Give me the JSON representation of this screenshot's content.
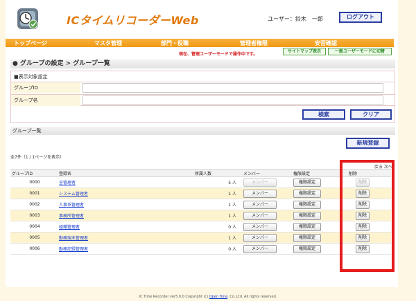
{
  "app": {
    "title": "ICタイムリコーダーWeb"
  },
  "header": {
    "user_label": "ユーザー：鈴木　一郎",
    "logout_label": "ログアウト"
  },
  "nav": {
    "items": [
      "トップページ",
      "マスタ管理",
      "部門・役職",
      "管理者権限",
      "安否確認"
    ]
  },
  "mode": {
    "notice": "現在、管理ユーザーモードで操作中です。",
    "sitemap_label": "サイトマップ表示",
    "switch_label": "一般ユーザーモードに切替"
  },
  "page": {
    "breadcrumb": "● グループの設定 > グループ一覧"
  },
  "search": {
    "section_label": "■表示対象設定",
    "group_id_label": "グループID",
    "group_name_label": "グループ名",
    "group_id_value": "",
    "group_name_value": "",
    "search_label": "検索",
    "clear_label": "クリア"
  },
  "list": {
    "title": "グループ一覧",
    "new_label": "新規登録",
    "count_text": "全7件（1 / 1ページを表示）",
    "pager_text": "戻る 次へ",
    "headers": {
      "id": "グループID",
      "name": "登録名",
      "members_count": "所属人数",
      "members": "メンバー",
      "perm": "権限設定",
      "delete": "削除"
    },
    "rows": [
      {
        "id": "0000",
        "name": "全管理者",
        "count": "5 人",
        "member_label": "メンバー",
        "member_enabled": false,
        "perm_label": "権限設定",
        "delete_label": "削除",
        "delete_enabled": false
      },
      {
        "id": "0001",
        "name": "システム管理者",
        "count": "1 人",
        "member_label": "メンバー",
        "member_enabled": true,
        "perm_label": "権限設定",
        "delete_label": "削除",
        "delete_enabled": true
      },
      {
        "id": "0002",
        "name": "人事系管理者",
        "count": "1 人",
        "member_label": "メンバー",
        "member_enabled": true,
        "perm_label": "権限設定",
        "delete_label": "削除",
        "delete_enabled": true
      },
      {
        "id": "0003",
        "name": "事務所管理者",
        "count": "1 人",
        "member_label": "メンバー",
        "member_enabled": true,
        "perm_label": "権限設定",
        "delete_label": "削除",
        "delete_enabled": true
      },
      {
        "id": "0004",
        "name": "組織管理者",
        "count": "0 人",
        "member_label": "メンバー",
        "member_enabled": true,
        "perm_label": "権限設定",
        "delete_label": "削除",
        "delete_enabled": true
      },
      {
        "id": "0005",
        "name": "勤務端末管理者",
        "count": "1 人",
        "member_label": "メンバー",
        "member_enabled": true,
        "perm_label": "権限設定",
        "delete_label": "削除",
        "delete_enabled": true
      },
      {
        "id": "0006",
        "name": "勤務記録管理者",
        "count": "0 人",
        "member_label": "メンバー",
        "member_enabled": true,
        "perm_label": "権限設定",
        "delete_label": "削除",
        "delete_enabled": true
      }
    ]
  },
  "footer": {
    "prefix": "IC Time Recorder ver5.0.0 Copyright (c) ",
    "company": "Open Tone",
    "suffix": ", Co.,Ltd. All rights reserved."
  },
  "colors": {
    "nav": "#f19a14",
    "accent_blue": "#2a3da0",
    "highlight": "#e41c1c",
    "row_alt": "#fdf4cf"
  }
}
